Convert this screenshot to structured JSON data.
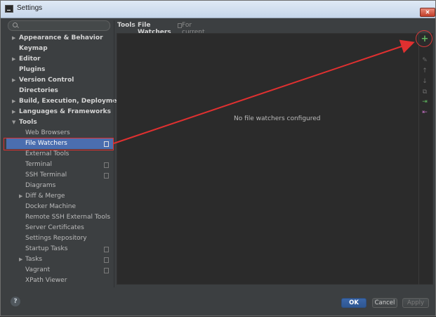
{
  "window": {
    "title": "Settings",
    "close_label": "✕"
  },
  "search": {
    "placeholder": "",
    "value": ""
  },
  "tree": [
    {
      "label": "Appearance & Behavior",
      "bold": true,
      "arrow": "▶",
      "depth": 0
    },
    {
      "label": "Keymap",
      "bold": true,
      "arrow": "",
      "depth": 0
    },
    {
      "label": "Editor",
      "bold": true,
      "arrow": "▶",
      "depth": 0
    },
    {
      "label": "Plugins",
      "bold": true,
      "arrow": "",
      "depth": 0
    },
    {
      "label": "Version Control",
      "bold": true,
      "arrow": "▶",
      "depth": 0
    },
    {
      "label": "Directories",
      "bold": true,
      "arrow": "",
      "depth": 0
    },
    {
      "label": "Build, Execution, Deployment",
      "bold": true,
      "arrow": "▶",
      "depth": 0
    },
    {
      "label": "Languages & Frameworks",
      "bold": true,
      "arrow": "▶",
      "depth": 0
    },
    {
      "label": "Tools",
      "bold": true,
      "arrow": "▼",
      "depth": 0
    },
    {
      "label": "Web Browsers",
      "bold": false,
      "arrow": "",
      "depth": 1
    },
    {
      "label": "File Watchers",
      "bold": false,
      "arrow": "",
      "depth": 1,
      "selected": true,
      "project_icon": true
    },
    {
      "label": "External Tools",
      "bold": false,
      "arrow": "",
      "depth": 1
    },
    {
      "label": "Terminal",
      "bold": false,
      "arrow": "",
      "depth": 1,
      "project_icon": true
    },
    {
      "label": "SSH Terminal",
      "bold": false,
      "arrow": "",
      "depth": 1,
      "project_icon": true
    },
    {
      "label": "Diagrams",
      "bold": false,
      "arrow": "",
      "depth": 1
    },
    {
      "label": "Diff & Merge",
      "bold": false,
      "arrow": "▶",
      "depth": 1
    },
    {
      "label": "Docker Machine",
      "bold": false,
      "arrow": "",
      "depth": 1
    },
    {
      "label": "Remote SSH External Tools",
      "bold": false,
      "arrow": "",
      "depth": 1
    },
    {
      "label": "Server Certificates",
      "bold": false,
      "arrow": "",
      "depth": 1
    },
    {
      "label": "Settings Repository",
      "bold": false,
      "arrow": "",
      "depth": 1
    },
    {
      "label": "Startup Tasks",
      "bold": false,
      "arrow": "",
      "depth": 1,
      "project_icon": true
    },
    {
      "label": "Tasks",
      "bold": false,
      "arrow": "▶",
      "depth": 1,
      "project_icon": true
    },
    {
      "label": "Vagrant",
      "bold": false,
      "arrow": "",
      "depth": 1,
      "project_icon": true
    },
    {
      "label": "XPath Viewer",
      "bold": false,
      "arrow": "",
      "depth": 1
    }
  ],
  "breadcrumb": {
    "parent": "Tools",
    "separator": "›",
    "current": "File Watchers",
    "scope": "For current project"
  },
  "panel": {
    "empty_text": "No file watchers configured"
  },
  "toolbar": [
    {
      "name": "add-icon",
      "glyph": "+",
      "color": "#5fb85f"
    },
    {
      "name": "edit-icon",
      "glyph": "✎",
      "color": "#6b6b6b"
    },
    {
      "name": "move-up-icon",
      "glyph": "↑",
      "color": "#6b6b6b"
    },
    {
      "name": "move-down-icon",
      "glyph": "↓",
      "color": "#6b6b6b"
    },
    {
      "name": "copy-icon",
      "glyph": "⧉",
      "color": "#6b6b6b"
    },
    {
      "name": "import-icon",
      "glyph": "⇥",
      "color": "#5fb85f"
    },
    {
      "name": "export-icon",
      "glyph": "⇤",
      "color": "#c06ec0"
    }
  ],
  "footer": {
    "help_label": "?",
    "ok_label": "OK",
    "cancel_label": "Cancel",
    "apply_label": "Apply"
  },
  "colors": {
    "background": "#3c3f41",
    "selection": "#4b6eaf",
    "annotation_red": "#e03030"
  }
}
